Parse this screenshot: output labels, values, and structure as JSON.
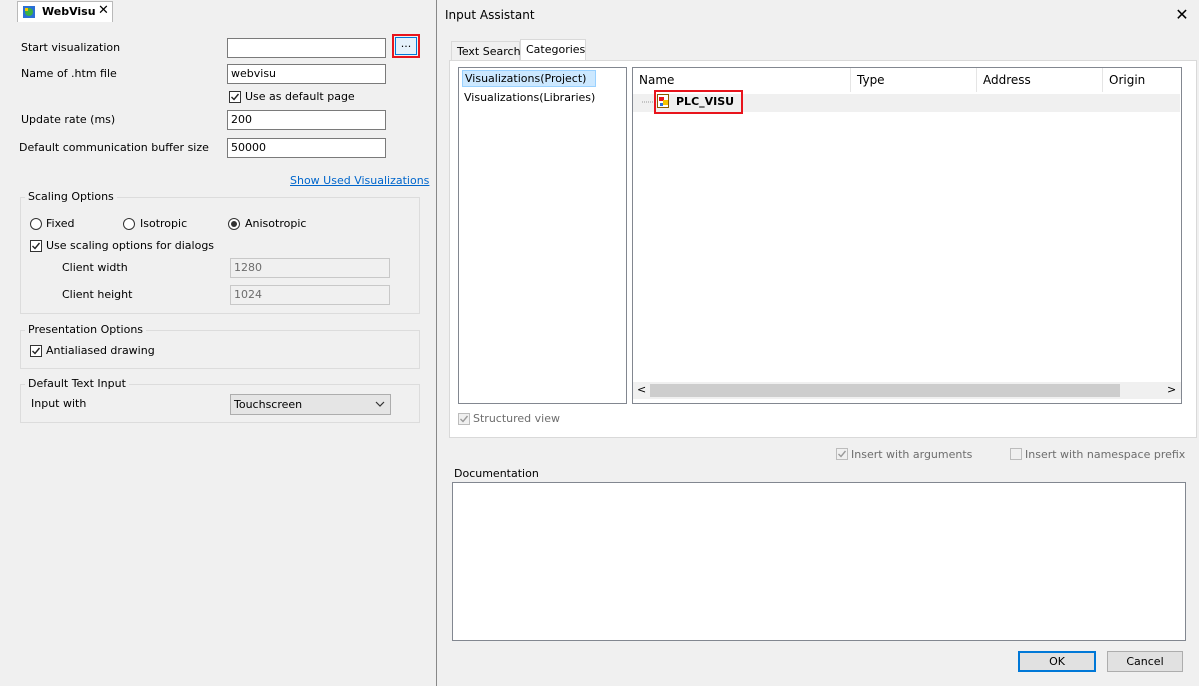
{
  "editor": {
    "tab_title": "WebVisu",
    "fields": {
      "start_visualization_label": "Start visualization",
      "start_visualization_value": "",
      "browse_label": "...",
      "htm_file_label": "Name of .htm file",
      "htm_file_value": "webvisu",
      "default_page_label": "Use as default page",
      "update_rate_label": "Update rate (ms)",
      "update_rate_value": "200",
      "buffer_size_label": "Default communication buffer size",
      "buffer_size_value": "50000"
    },
    "show_used_link": "Show Used Visualizations",
    "scaling": {
      "title": "Scaling Options",
      "fixed_label": "Fixed",
      "isotropic_label": "Isotropic",
      "anisotropic_label": "Anisotropic",
      "selected": "Anisotropic",
      "use_for_dialogs_label": "Use scaling options for dialogs",
      "client_width_label": "Client width",
      "client_width_value": "1280",
      "client_height_label": "Client height",
      "client_height_value": "1024"
    },
    "presentation": {
      "title": "Presentation Options",
      "antialiased_label": "Antialiased drawing"
    },
    "text_input": {
      "title": "Default Text Input",
      "input_with_label": "Input with",
      "input_with_value": "Touchscreen"
    }
  },
  "dialog": {
    "title": "Input Assistant",
    "tabs": [
      "Text Search",
      "Categories"
    ],
    "active_tab": "Categories",
    "categories": [
      "Visualizations(Project)",
      "Visualizations(Libraries)"
    ],
    "selected_category": "Visualizations(Project)",
    "columns": [
      "Name",
      "Type",
      "Address",
      "Origin"
    ],
    "rows": [
      {
        "name": "PLC_VISU"
      }
    ],
    "structured_view_label": "Structured view",
    "insert_with_arguments_label": "Insert with arguments",
    "insert_with_namespace_label": "Insert with namespace prefix",
    "documentation_label": "Documentation",
    "ok_label": "OK",
    "cancel_label": "Cancel"
  },
  "colors": {
    "highlight_frame": "#e8141c",
    "accent": "#0078d7",
    "link": "#0066cc",
    "selection": "#cce8ff"
  }
}
